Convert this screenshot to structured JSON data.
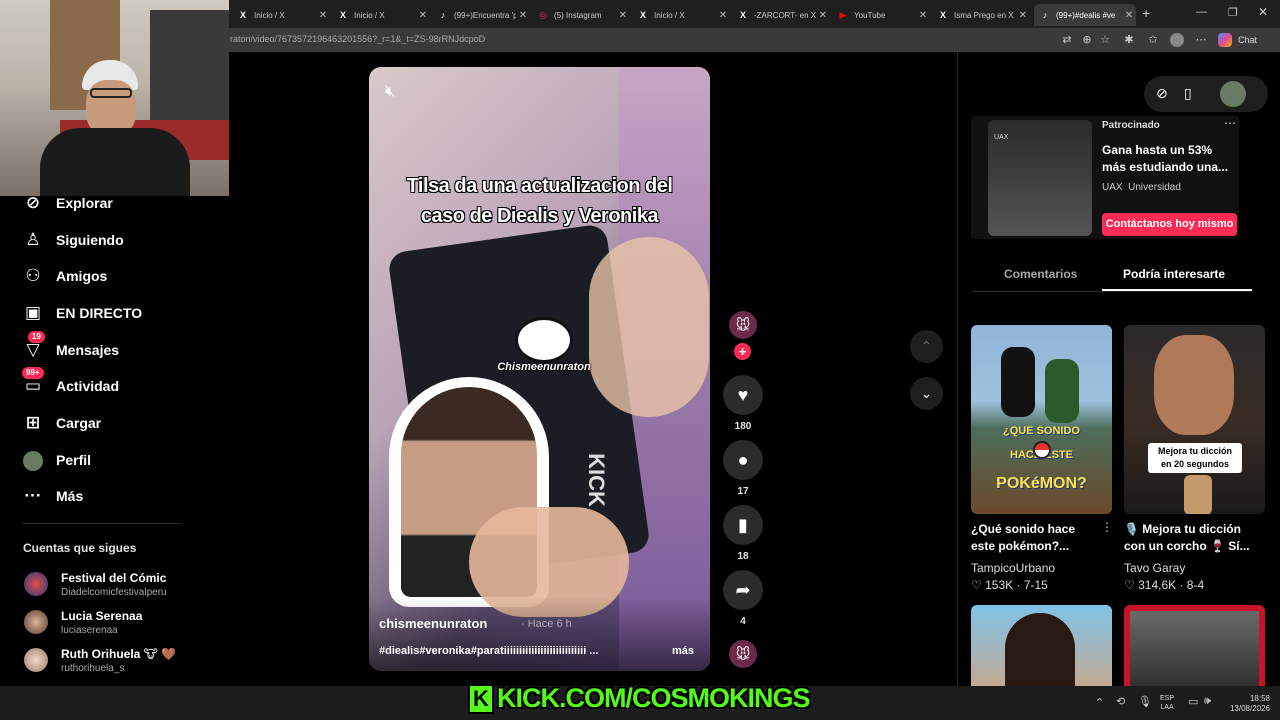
{
  "browser": {
    "tabs": [
      {
        "title": "Inicio / X",
        "icon": "X"
      },
      {
        "title": "Inicio / X",
        "icon": "X"
      },
      {
        "title": "(99+)Encuentra 'p",
        "icon": "♪"
      },
      {
        "title": "(5) Instagram",
        "icon": "◎"
      },
      {
        "title": "Inicio / X",
        "icon": "X"
      },
      {
        "title": "-ZARCORT- en X",
        "icon": "X"
      },
      {
        "title": "YouTube",
        "icon": "▶"
      },
      {
        "title": "Isma Prego en X",
        "icon": "X"
      },
      {
        "title": "(99+)#dealis #ve",
        "icon": "♪"
      }
    ],
    "url": "raton/video/7673572196463201556?_r=1&_t=ZS-98rRNJdcpoD",
    "chat_label": "Chat"
  },
  "sidebar": {
    "nav": [
      {
        "label": "Explorar",
        "icon": "compass-icon"
      },
      {
        "label": "Siguiendo",
        "icon": "user-follow-icon"
      },
      {
        "label": "Amigos",
        "icon": "friends-icon"
      },
      {
        "label": "EN DIRECTO",
        "icon": "live-icon"
      },
      {
        "label": "Mensajes",
        "icon": "message-icon",
        "badge": "19"
      },
      {
        "label": "Actividad",
        "icon": "activity-icon",
        "badge": "99+"
      },
      {
        "label": "Cargar",
        "icon": "upload-icon"
      },
      {
        "label": "Perfil",
        "icon": "avatar"
      },
      {
        "label": "Más",
        "icon": "more-icon"
      }
    ],
    "following_title": "Cuentas que sigues",
    "following": [
      {
        "name": "Festival del Cómic",
        "handle": "Diadelcomicfestivalperu"
      },
      {
        "name": "Lucia Serenaa",
        "handle": "luciaserenaa"
      },
      {
        "name": "Ruth Orihuela 🐮 🤎",
        "handle": "ruthorihuela_s"
      }
    ]
  },
  "video": {
    "caption_line1": "Tilsa da una actualizacion  del",
    "caption_line2": "caso de Diealis y Veronika",
    "watermark": "Chismeenunraton",
    "author": "chismeenunraton",
    "time_ago": "· Hace 6 h",
    "hashtags": "#diealis#veronika#paratiiiiiiiiiiiiiiiiiiiiiiiiiii ...",
    "more_label": "más",
    "phone_text": "KICK"
  },
  "actions": {
    "likes": "180",
    "comments": "17",
    "saves": "18",
    "shares": "4"
  },
  "ad": {
    "sponsored": "Patrocinado",
    "title": "Gana hasta un 53% más estudiando una...",
    "brand": "UAX",
    "brand_sub": "Universidad",
    "cta": "Contáctanos hoy mismo",
    "thumb_label": "UAX"
  },
  "panel_tabs": {
    "comments": "Comentarios",
    "related": "Podría interesarte"
  },
  "related": [
    {
      "title": "¿Qué sonido hace este pokémon?...",
      "author": "TampicoUrbano",
      "stats": "♡ 153K · 7-15",
      "overlay1": "¿QUE SONIDO",
      "overlay2": "HACE  ESTE",
      "overlay3": "POKéMON?"
    },
    {
      "title": "🎙️ Mejora tu dicción con un corcho 🍷 Sí...",
      "author": "Tavo Garay",
      "stats": "♡ 314,6K · 8-4",
      "overlay1": "Mejora tu dicción",
      "overlay2": "en 20 segundos"
    }
  ],
  "stream_banner": "KICK.COM/COSMOKINGS",
  "taskbar": {
    "lang1": "ESP",
    "lang2": "LAA",
    "time": "18:58",
    "date": "13/08/2026"
  },
  "colors": {
    "accent": "#fe2c55",
    "kick_green": "#53fc18"
  }
}
